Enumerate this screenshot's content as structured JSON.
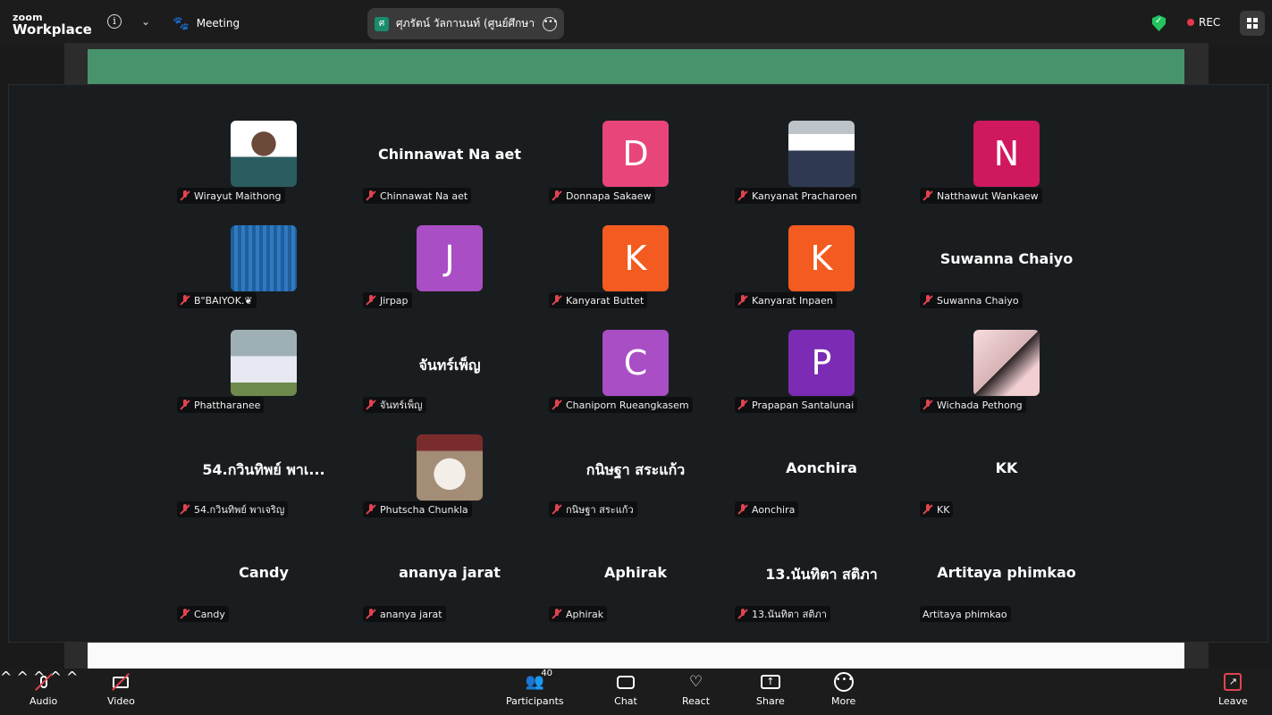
{
  "app": {
    "logo_top": "zoom",
    "logo_bottom": "Workplace"
  },
  "topbar": {
    "meeting_label": "Meeting",
    "active_speaker": {
      "initial": "ศ",
      "name": "ศุภรัตน์ วัลกานนท์ (ศูนย์ศึกษานานา"
    },
    "rec_label": "REC"
  },
  "participants": [
    {
      "name": "Wirayut Maithong",
      "display": "",
      "type": "photo",
      "photo": "p1",
      "muted": true
    },
    {
      "name": "Chinnawat Na aet",
      "display": "Chinnawat Na aet",
      "type": "name",
      "muted": true
    },
    {
      "name": "Donnapa Sakaew",
      "display": "D",
      "type": "avatar",
      "color": "#e8457a",
      "muted": true
    },
    {
      "name": "Kanyanat Pracharoen",
      "display": "",
      "type": "photo",
      "photo": "p2",
      "muted": true
    },
    {
      "name": "Natthawut Wankaew",
      "display": "N",
      "type": "avatar",
      "color": "#d0185f",
      "muted": true
    },
    {
      "name": "B\"BAIYOK.❦",
      "display": "",
      "type": "photo",
      "photo": "p3",
      "muted": true
    },
    {
      "name": "Jirpap",
      "display": "J",
      "type": "avatar",
      "color": "#a94ec4",
      "muted": true
    },
    {
      "name": "Kanyarat Buttet",
      "display": "K",
      "type": "avatar",
      "color": "#f45b20",
      "muted": true
    },
    {
      "name": "Kanyarat Inpaen",
      "display": "K",
      "type": "avatar",
      "color": "#f45b20",
      "muted": true
    },
    {
      "name": "Suwanna Chaiyo",
      "display": "Suwanna Chaiyo",
      "type": "name",
      "muted": true
    },
    {
      "name": "Phattharanee",
      "display": "",
      "type": "photo",
      "photo": "p4",
      "muted": true
    },
    {
      "name": "จันทร์เพ็ญ",
      "display": "จันทร์เพ็ญ",
      "type": "name",
      "muted": true
    },
    {
      "name": "Chaniporn Rueangkasem",
      "display": "C",
      "type": "avatar",
      "color": "#a94ec4",
      "muted": true
    },
    {
      "name": "Prapapan Santalunai",
      "display": "P",
      "type": "avatar",
      "color": "#7b2bb4",
      "muted": true
    },
    {
      "name": "Wichada Pethong",
      "display": "",
      "type": "photo",
      "photo": "p5",
      "muted": true
    },
    {
      "name": "54.กวินทิพย์ พาเจริญ",
      "display": "54.กวินทิพย์ พาเ...",
      "type": "name",
      "muted": true
    },
    {
      "name": "Phutscha Chunkla",
      "display": "",
      "type": "photo",
      "photo": "p6",
      "muted": true
    },
    {
      "name": "กนิษฐา สระแก้ว",
      "display": "กนิษฐา สระแก้ว",
      "type": "name",
      "muted": true
    },
    {
      "name": "Aonchira",
      "display": "Aonchira",
      "type": "name",
      "muted": true
    },
    {
      "name": "KK",
      "display": "KK",
      "type": "name",
      "muted": true
    },
    {
      "name": "Candy",
      "display": "Candy",
      "type": "name",
      "muted": true
    },
    {
      "name": "ananya jarat",
      "display": "ananya jarat",
      "type": "name",
      "muted": true
    },
    {
      "name": "Aphirak",
      "display": "Aphirak",
      "type": "name",
      "muted": true
    },
    {
      "name": "13.นันทิตา สติภา",
      "display": "13.นันทิตา สติภา",
      "type": "name",
      "muted": true
    },
    {
      "name": "Artitaya phimkao",
      "display": "Artitaya phimkao",
      "type": "name",
      "muted": false
    }
  ],
  "toolbar": {
    "audio": "Audio",
    "video": "Video",
    "participants": "Participants",
    "participants_count": "40",
    "chat": "Chat",
    "react": "React",
    "share": "Share",
    "more": "More",
    "leave": "Leave"
  }
}
